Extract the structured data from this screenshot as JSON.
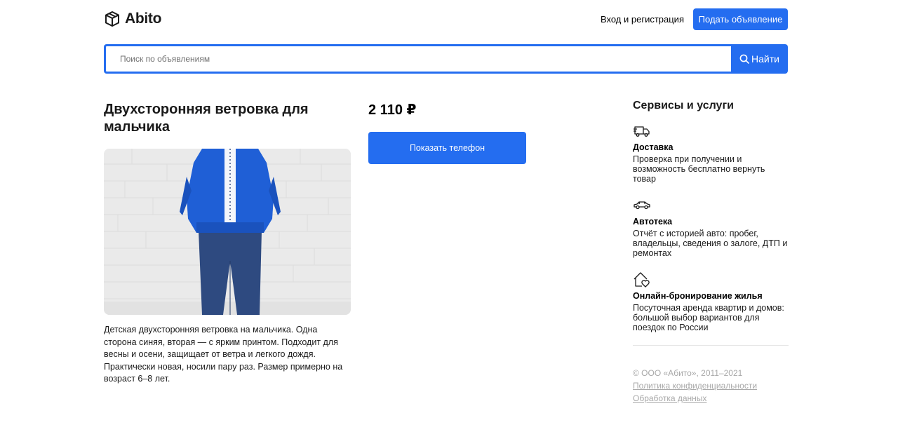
{
  "header": {
    "logo_text": "Abito",
    "logo_icon": "box-icon",
    "login_label": "Вход и регистрация",
    "post_button_label": "Подать объявление"
  },
  "search": {
    "placeholder": "Поиск по объявлениям",
    "value": "",
    "button_label": "Найти",
    "icon": "search-icon"
  },
  "item": {
    "title": "Двухсторонняя ветровка для мальчика",
    "price": "2 110 ₽",
    "phone_button_label": "Показать телефон",
    "description": "Детская двухсторонняя ветровка на мальчика. Одна сторона синяя, вторая — с ярким принтом. Подходит для весны и осени, защищает от ветра и легкого дождя. Практически новая, носили пару раз. Размер примерно на возраст 6–8 лет."
  },
  "services": {
    "title": "Сервисы и услуги",
    "items": [
      {
        "icon": "delivery-truck-icon",
        "name": "Доставка",
        "description": "Проверка при получении и возможность бесплатно вернуть товар"
      },
      {
        "icon": "car-icon",
        "name": "Автотека",
        "description": "Отчёт с историей авто: пробег, владельцы, сведения о залоге, ДТП и ремонтах"
      },
      {
        "icon": "house-heart-icon",
        "name": "Онлайн-бронирование жилья",
        "description": "Посуточная аренда квартир и домов: большой выбор вариантов для поездок по России"
      }
    ]
  },
  "footer": {
    "copyright": "© ООО «Абито», 2011–2021",
    "privacy_link": "Политика конфиденциальности",
    "data_link": "Обработка данных"
  },
  "colors": {
    "accent": "#246df0",
    "text": "#1a1a1a",
    "footer_text": "#a8a8a8",
    "jacket": "#1f5fd6",
    "jeans": "#2e4a80"
  }
}
